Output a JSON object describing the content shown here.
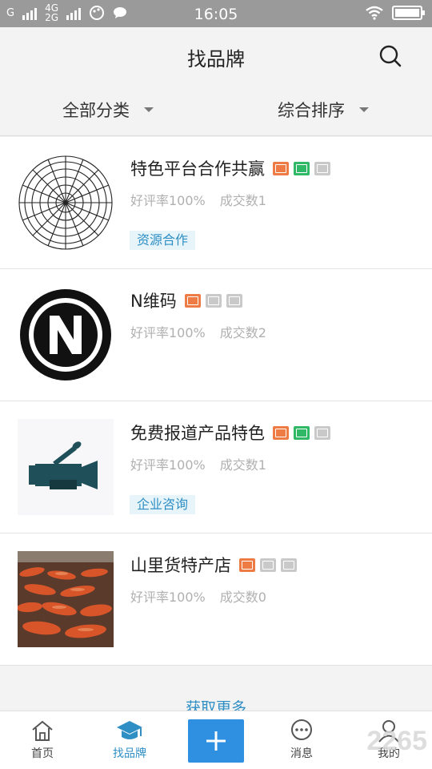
{
  "status_bar": {
    "time": "16:05",
    "carrier_left": "G",
    "network_top": "4G",
    "network_bottom": "2G"
  },
  "header": {
    "title": "找品牌"
  },
  "filters": {
    "category": "全部分类",
    "sort": "综合排序"
  },
  "stats_labels": {
    "rating": "好评率",
    "deals": "成交数"
  },
  "items": [
    {
      "name": "特色平台合作共赢",
      "rating": "好评率100%",
      "deals": "成交数1",
      "tag": "资源合作",
      "badges": [
        "orange-id",
        "green-mail",
        "gray-biz"
      ],
      "thumb": "spiderweb"
    },
    {
      "name": "N维码",
      "rating": "好评率100%",
      "deals": "成交数2",
      "tag": "",
      "badges": [
        "orange-id",
        "gray-mail",
        "gray-biz"
      ],
      "thumb": "n-logo"
    },
    {
      "name": "免费报道产品特色",
      "rating": "好评率100%",
      "deals": "成交数1",
      "tag": "企业咨询",
      "badges": [
        "orange-id",
        "green-mail",
        "gray-biz"
      ],
      "thumb": "camera"
    },
    {
      "name": "山里货特产店",
      "rating": "好评率100%",
      "deals": "成交数0",
      "tag": "",
      "badges": [
        "orange-id",
        "gray-mail",
        "gray-biz"
      ],
      "thumb": "dried-food"
    }
  ],
  "load_more": "获取更多",
  "bottom_nav": [
    {
      "label": "首页",
      "icon": "home-icon"
    },
    {
      "label": "找品牌",
      "icon": "graduation-cap-icon",
      "active": true
    },
    {
      "label": "",
      "icon": "plus-icon"
    },
    {
      "label": "消息",
      "icon": "chat-bubble-icon"
    },
    {
      "label": "我的",
      "icon": "person-icon"
    }
  ],
  "watermark": "2265",
  "colors": {
    "accent": "#2f8fc4",
    "plus_button": "#2f8fe0",
    "badge_orange": "#ee7b44",
    "badge_green": "#2fb866",
    "badge_gray": "#c9c9c9"
  }
}
